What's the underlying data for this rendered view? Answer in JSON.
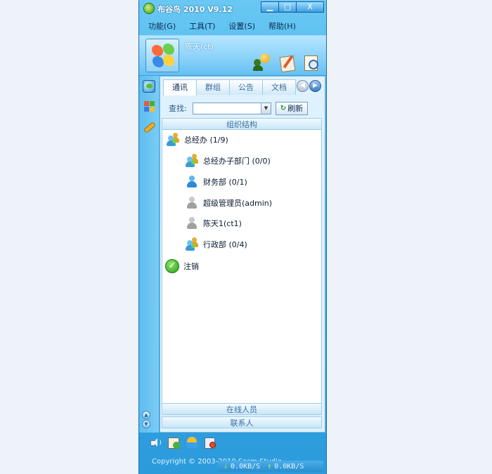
{
  "window": {
    "title": "布谷鸟 2010 V9.12",
    "minimize_label": "▁",
    "maximize_label": "□",
    "close_label": "X"
  },
  "menu": {
    "items": [
      {
        "label": "功能(G)"
      },
      {
        "label": "工具(T)"
      },
      {
        "label": "设置(S)"
      },
      {
        "label": "帮助(H)"
      }
    ]
  },
  "profile": {
    "username": "陈天(ct)",
    "actions": [
      "emoticon-user-icon",
      "edit-notes-icon",
      "search-doc-icon"
    ]
  },
  "sidebar": {
    "icons": [
      "bird-logo-icon",
      "apps-icon",
      "phone-icon"
    ]
  },
  "tabs": [
    {
      "label": "通讯",
      "active": true
    },
    {
      "label": "群组",
      "active": false
    },
    {
      "label": "公告",
      "active": false
    },
    {
      "label": "文档",
      "active": false
    }
  ],
  "search": {
    "label": "查找:",
    "value": "",
    "refresh_label": "刷新"
  },
  "sections": {
    "org_structure": "组织结构",
    "online_members": "在线人员",
    "contacts": "联系人"
  },
  "tree": {
    "root": {
      "label": "总经办 (1/9)",
      "icon": "group-icon"
    },
    "children": [
      {
        "label": "总经办子部门 (0/0)",
        "icon": "group-icon"
      },
      {
        "label": "财务部 (0/1)",
        "icon": "person-online-icon"
      },
      {
        "label": "超级管理员(admin)",
        "icon": "person-offline-icon"
      },
      {
        "label": "陈天1(ct1)",
        "icon": "person-offline-icon"
      },
      {
        "label": "行政部 (0/4)",
        "icon": "group-icon"
      }
    ],
    "logout": {
      "label": "注销",
      "icon": "check-icon"
    }
  },
  "bottom_toolbar": {
    "icons": [
      "speaker-icon",
      "message-manager-icon",
      "transfer-icon",
      "settings-doc-icon"
    ]
  },
  "footer": {
    "copyright": "Copyright © 2003-2010 Sccm Studio",
    "download_speed": "0.0KB/S",
    "upload_speed": "0.0KB/S"
  },
  "colors": {
    "window_blue": "#3aa9e5",
    "panel_bg": "#dff1fc",
    "accent_green": "#2a9a1a"
  }
}
